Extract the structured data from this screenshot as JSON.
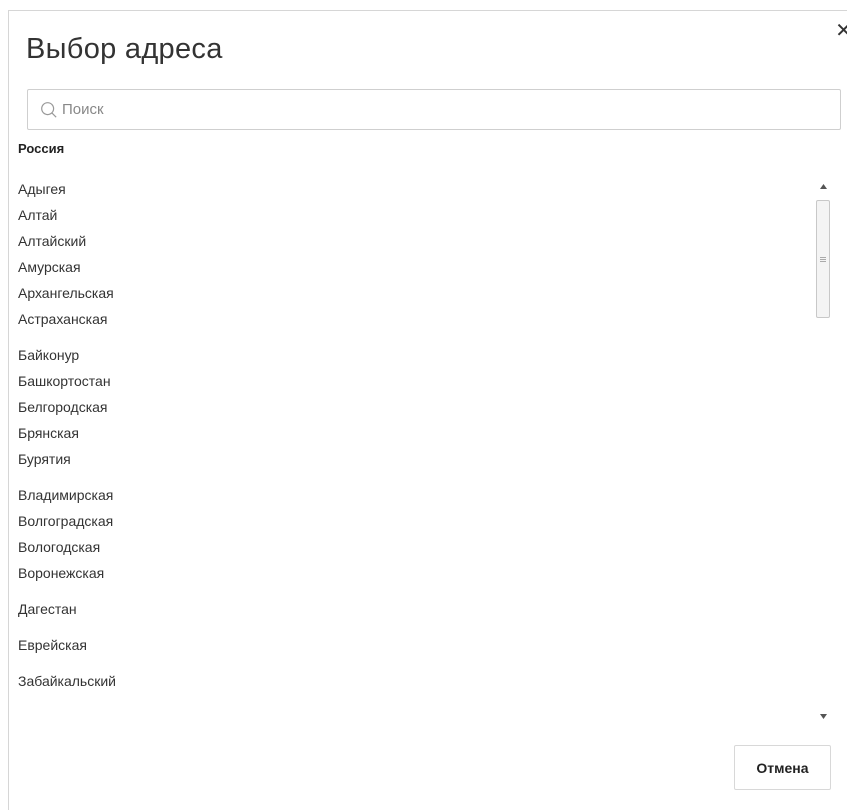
{
  "dialog": {
    "title": "Выбор адреса",
    "close_label": "✕"
  },
  "search": {
    "placeholder": "Поиск",
    "value": ""
  },
  "country": "Россия",
  "region_groups": [
    [
      "Адыгея",
      "Алтай",
      "Алтайский",
      "Амурская",
      "Архангельская",
      "Астраханская"
    ],
    [
      "Байконур",
      "Башкортостан",
      "Белгородская",
      "Брянская",
      "Бурятия"
    ],
    [
      "Владимирская",
      "Волгоградская",
      "Вологодская",
      "Воронежская"
    ],
    [
      "Дагестан"
    ],
    [
      "Еврейская"
    ],
    [
      "Забайкальский"
    ]
  ],
  "footer": {
    "cancel_label": "Отмена"
  }
}
